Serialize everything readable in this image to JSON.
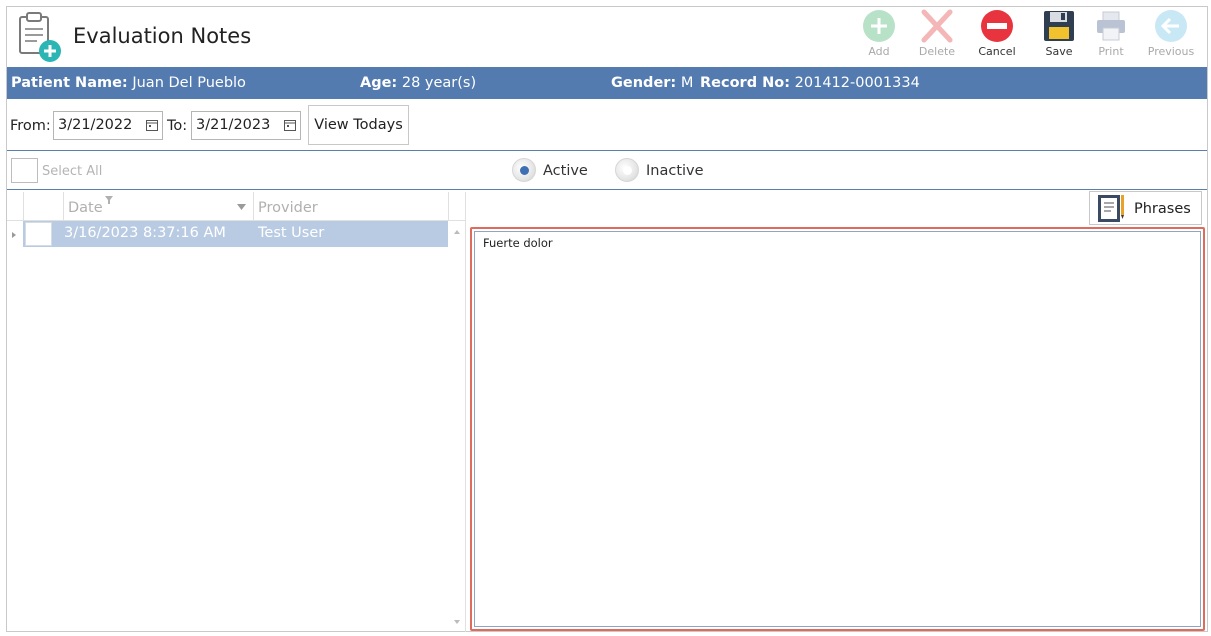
{
  "app": {
    "title": "Evaluation Notes"
  },
  "toolbar": {
    "add_label": "Add",
    "delete_label": "Delete",
    "cancel_label": "Cancel",
    "save_label": "Save",
    "print_label": "Print",
    "previous_label": "Previous"
  },
  "patient": {
    "name_label": "Patient Name:",
    "name_value": "Juan Del Pueblo",
    "age_label": "Age:",
    "age_value": "28 year(s)",
    "gender_label": "Gender:",
    "gender_value": "M",
    "record_label": "Record No:",
    "record_value": "201412-0001334"
  },
  "filters": {
    "from_label": "From:",
    "from_value": "3/21/2022",
    "to_label": "To:",
    "to_value": "3/21/2023",
    "view_todays_label": "View Todays",
    "select_all_label": "Select All",
    "active_label": "Active",
    "inactive_label": "Inactive",
    "active_selected": true
  },
  "grid": {
    "columns": [
      "Date",
      "Provider"
    ],
    "rows": [
      {
        "date": "3/16/2023 8:37:16 AM",
        "provider": "Test User"
      }
    ]
  },
  "note": {
    "phrases_label": "Phrases",
    "text": "Fuerte dolor"
  },
  "colors": {
    "band": "#547bb0",
    "selected_row": "#b9cbe3",
    "focus_border": "#e06b5d",
    "radio_selected": "#3f6fb3"
  }
}
